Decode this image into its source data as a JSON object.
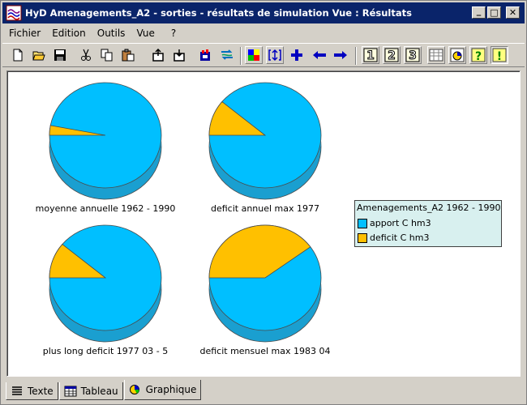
{
  "window": {
    "title": "HyD Amenagements_A2 - sorties - résultats de simulation Vue  : Résultats",
    "minimize_glyph": "_",
    "maximize_glyph": "□",
    "close_glyph": "✕"
  },
  "menu": {
    "items": [
      {
        "label": "Fichier"
      },
      {
        "label": "Edition"
      },
      {
        "label": "Outils"
      },
      {
        "label": "Vue"
      },
      {
        "label": "?"
      }
    ]
  },
  "toolbar": {
    "buttons": [
      {
        "icon": "new-icon"
      },
      {
        "icon": "open-icon"
      },
      {
        "icon": "save-icon"
      },
      {
        "icon": "cut-icon"
      },
      {
        "icon": "copy-icon"
      },
      {
        "icon": "paste-icon"
      },
      {
        "icon": "export-icon"
      },
      {
        "icon": "import-icon"
      },
      {
        "icon": "compute-icon"
      },
      {
        "icon": "swap-icon"
      },
      {
        "icon": "color-grid-icon"
      },
      {
        "icon": "zoom-fit-icon"
      },
      {
        "icon": "add-icon"
      },
      {
        "icon": "arrow-left-icon"
      },
      {
        "icon": "arrow-right-icon"
      },
      {
        "icon": "view-1-icon",
        "label": "1"
      },
      {
        "icon": "view-2-icon",
        "label": "2"
      },
      {
        "icon": "view-3-icon",
        "label": "3"
      },
      {
        "icon": "table-icon"
      },
      {
        "icon": "chart-icon"
      },
      {
        "icon": "help-icon"
      },
      {
        "icon": "info-icon"
      }
    ]
  },
  "chart": {
    "colors": {
      "apport": "#00bfff",
      "deficit": "#ffc000",
      "apport_side": "#1a9fd0",
      "deficit_side": "#c89a00"
    },
    "legend": {
      "title": "Amenagements_A2 1962 - 1990",
      "items": [
        {
          "label": "apport C hm3",
          "color": "#00bfff"
        },
        {
          "label": "deficit C hm3",
          "color": "#ffc000"
        }
      ]
    }
  },
  "chart_data": {
    "type": "pie",
    "series_labels": [
      "apport C hm3",
      "deficit C hm3"
    ],
    "pies": [
      {
        "title": "moyenne annuelle 1962 - 1990",
        "values": [
          97,
          3
        ]
      },
      {
        "title": "deficit annuel max 1977",
        "values": [
          89,
          11
        ]
      },
      {
        "title": "plus long deficit 1977 03 - 5",
        "values": [
          89,
          11
        ]
      },
      {
        "title": "deficit mensuel max 1983 04",
        "values": [
          60,
          40
        ]
      }
    ]
  },
  "tabs": [
    {
      "label": "Texte",
      "icon": "text-icon"
    },
    {
      "label": "Tableau",
      "icon": "table-icon"
    },
    {
      "label": "Graphique",
      "icon": "chart-icon"
    }
  ]
}
